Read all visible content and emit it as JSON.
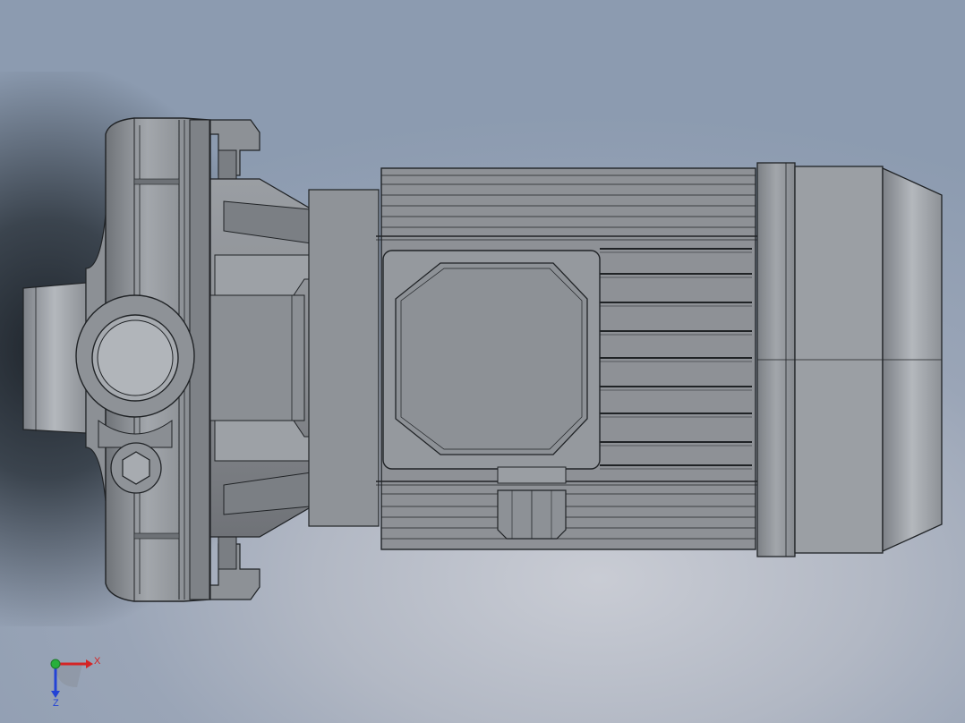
{
  "viewport": {
    "model_name": "",
    "background_top": "#8c9bb0",
    "background_bottom": "#c9ccd4"
  },
  "model": {
    "body_color": "#8f9296",
    "edge_color": "#202326",
    "highlight_color": "#c2c6cb"
  },
  "triad": {
    "x_label": "X",
    "z_label": "Z",
    "x_color": "#d42525",
    "y_color": "#27b03a",
    "z_color": "#2343d6"
  }
}
